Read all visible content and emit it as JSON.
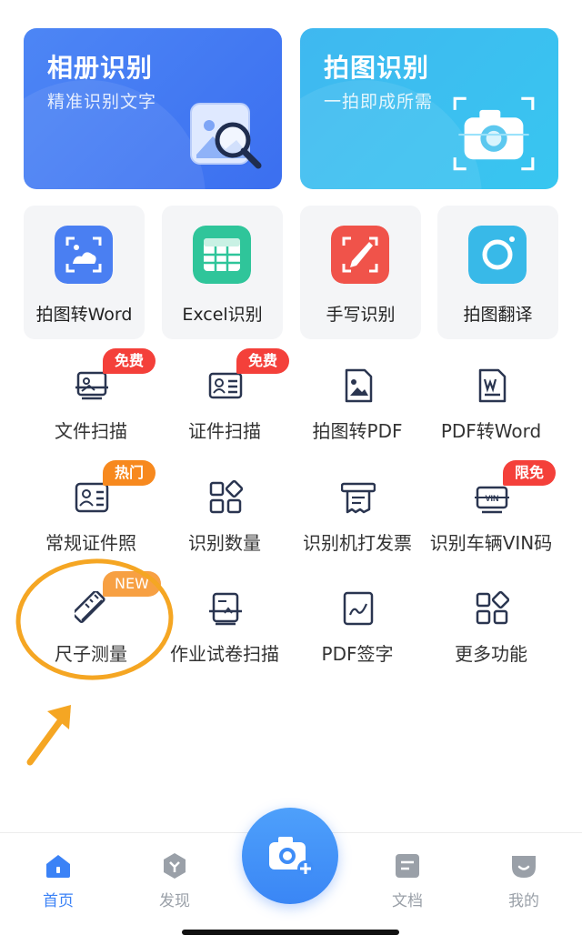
{
  "top_cards": [
    {
      "title": "相册识别",
      "subtitle": "精准识别文字"
    },
    {
      "title": "拍图识别",
      "subtitle": "一拍即成所需"
    }
  ],
  "tiles": [
    {
      "label": "拍图转Word",
      "icon": "image-scan-icon",
      "color": "#4a7ff2"
    },
    {
      "label": "Excel识别",
      "icon": "spreadsheet-icon",
      "color": "#2fc59a"
    },
    {
      "label": "手写识别",
      "icon": "pen-icon",
      "color": "#f0534a"
    },
    {
      "label": "拍图翻译",
      "icon": "camera-icon",
      "color": "#38b9e8"
    }
  ],
  "features": [
    {
      "label": "文件扫描",
      "icon": "document-scan-icon",
      "badge": "免费"
    },
    {
      "label": "证件扫描",
      "icon": "id-card-icon",
      "badge": "免费"
    },
    {
      "label": "拍图转PDF",
      "icon": "pdf-image-icon",
      "badge": ""
    },
    {
      "label": "PDF转Word",
      "icon": "word-file-icon",
      "badge": ""
    },
    {
      "label": "常规证件照",
      "icon": "id-photo-icon",
      "badge": "热门"
    },
    {
      "label": "识别数量",
      "icon": "count-grid-icon",
      "badge": ""
    },
    {
      "label": "识别机打发票",
      "icon": "invoice-icon",
      "badge": ""
    },
    {
      "label": "识别车辆VIN码",
      "icon": "vin-icon",
      "badge": "限免"
    },
    {
      "label": "尺子测量",
      "icon": "ruler-icon",
      "badge": "NEW"
    },
    {
      "label": "作业试卷扫描",
      "icon": "homework-scan-icon",
      "badge": ""
    },
    {
      "label": "PDF签字",
      "icon": "pdf-sign-icon",
      "badge": ""
    },
    {
      "label": "更多功能",
      "icon": "more-grid-icon",
      "badge": ""
    }
  ],
  "nav": [
    {
      "label": "首页",
      "icon": "home-icon",
      "active": true
    },
    {
      "label": "发现",
      "icon": "discover-icon",
      "active": false
    },
    {
      "label": "文档",
      "icon": "document-icon",
      "active": false
    },
    {
      "label": "我的",
      "icon": "profile-icon",
      "active": false
    }
  ],
  "colors": {
    "accent": "#3b82f6",
    "annotation": "#f5a623",
    "badge_red": "#f4403a",
    "badge_orange": "#f7891e"
  }
}
